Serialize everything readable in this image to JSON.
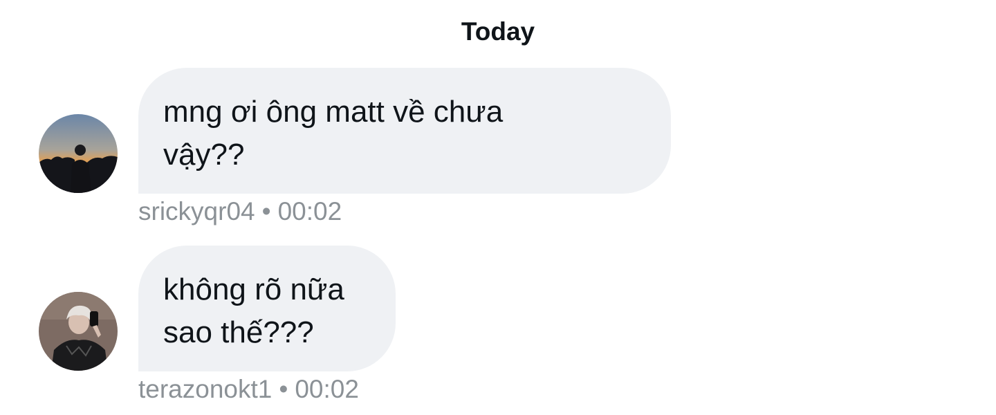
{
  "conversation": {
    "date_divider": "Today",
    "messages": [
      {
        "text": "mng ơi ông matt về chưa vậy??",
        "username": "srickyqr04",
        "separator": "•",
        "time": "00:02",
        "avatar_icon": "avatar-sunset-silhouette"
      },
      {
        "text": "không rõ nữa sao thế???",
        "username": "terazonokt1",
        "separator": "•",
        "time": "00:02",
        "avatar_icon": "avatar-mirror-selfie"
      }
    ]
  }
}
